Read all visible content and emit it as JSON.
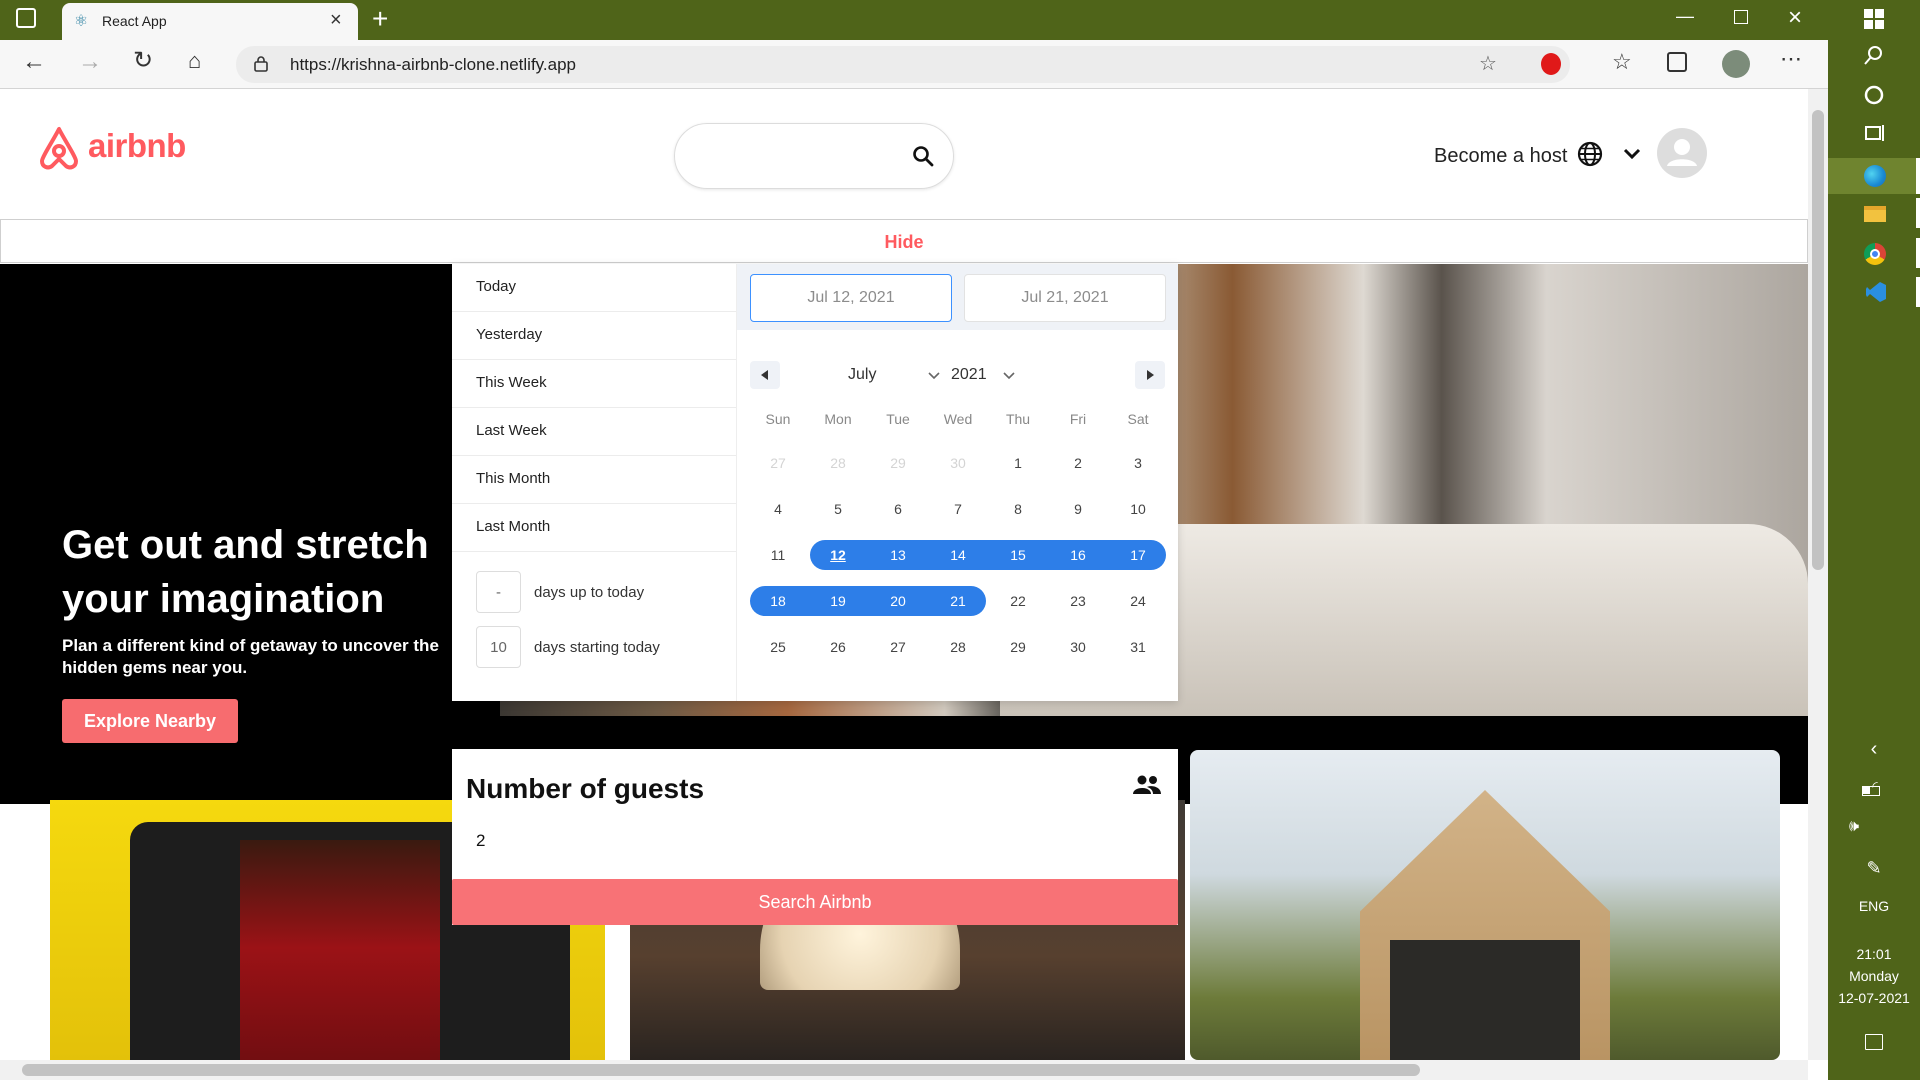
{
  "browser": {
    "tab_title": "React App",
    "url": "https://krishna-airbnb-clone.netlify.app",
    "icons": [
      "tab-actions-icon",
      "react-icon",
      "close-icon",
      "new-tab-icon",
      "back-icon",
      "forward-icon",
      "refresh-icon",
      "home-icon",
      "lock-icon",
      "add-favorite-icon",
      "extension-icon",
      "favorites-icon",
      "collections-icon",
      "profile-avatar",
      "more-icon"
    ]
  },
  "header": {
    "logo_text": "airbnb",
    "become_host": "Become a host",
    "search_placeholder": ""
  },
  "hide_bar": {
    "label": "Hide"
  },
  "hero": {
    "title_line1": "Get out and stretch",
    "title_line2": "your imagination",
    "subtitle_line1": "Plan a different kind of getaway to uncover the",
    "subtitle_line2": "hidden gems near you.",
    "button": "Explore Nearby"
  },
  "date_picker": {
    "ranges": [
      "Today",
      "Yesterday",
      "This Week",
      "Last Week",
      "This Month",
      "Last Month"
    ],
    "days_up_to_today": {
      "value": "-",
      "label": "days up to today"
    },
    "days_starting_today": {
      "value": "10",
      "label": "days starting today"
    },
    "start_date": "Jul 12, 2021",
    "end_date": "Jul 21, 2021",
    "month": "July",
    "year": "2021",
    "weekdays": [
      "Sun",
      "Mon",
      "Tue",
      "Wed",
      "Thu",
      "Fri",
      "Sat"
    ],
    "weeks": [
      [
        "27",
        "28",
        "29",
        "30",
        "1",
        "2",
        "3"
      ],
      [
        "4",
        "5",
        "6",
        "7",
        "8",
        "9",
        "10"
      ],
      [
        "11",
        "12",
        "13",
        "14",
        "15",
        "16",
        "17"
      ],
      [
        "18",
        "19",
        "20",
        "21",
        "22",
        "23",
        "24"
      ],
      [
        "25",
        "26",
        "27",
        "28",
        "29",
        "30",
        "31"
      ]
    ]
  },
  "guests": {
    "title": "Number of guests",
    "value": "2",
    "search_button": "Search Airbnb"
  },
  "taskbar": {
    "language": "ENG",
    "time": "21:01",
    "day": "Monday",
    "date": "12-07-2021"
  },
  "colors": {
    "brand": "#ff5a5f",
    "accent": "#2d7ee8",
    "chrome": "#4f6419"
  }
}
